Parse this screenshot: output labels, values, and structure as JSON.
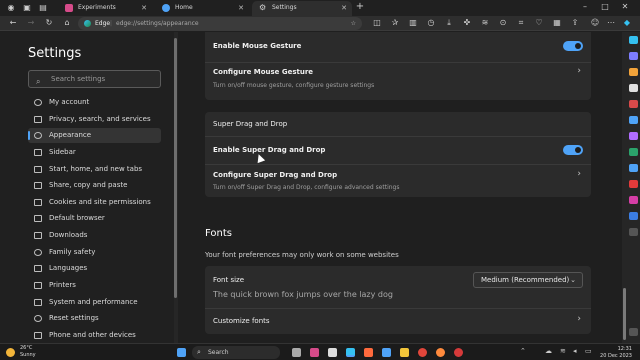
{
  "tabs": [
    {
      "label": "Experiments",
      "icon": "experiments-icon",
      "color": "#d64b8a"
    },
    {
      "label": "Home",
      "icon": "home-tab-icon",
      "color": "#4fa3f7"
    },
    {
      "label": "Settings",
      "icon": "gear-icon",
      "color": "#bdbdbd"
    }
  ],
  "address": {
    "browser_label": "Edge",
    "url": "edge://settings/appearance"
  },
  "sidebar": {
    "title": "Settings",
    "search_placeholder": "Search settings",
    "items": [
      {
        "label": "My account"
      },
      {
        "label": "Privacy, search, and services"
      },
      {
        "label": "Appearance"
      },
      {
        "label": "Sidebar"
      },
      {
        "label": "Start, home, and new tabs"
      },
      {
        "label": "Share, copy and paste"
      },
      {
        "label": "Cookies and site permissions"
      },
      {
        "label": "Default browser"
      },
      {
        "label": "Downloads"
      },
      {
        "label": "Family safety"
      },
      {
        "label": "Languages"
      },
      {
        "label": "Printers"
      },
      {
        "label": "System and performance"
      },
      {
        "label": "Reset settings"
      },
      {
        "label": "Phone and other devices"
      }
    ],
    "selected_index": 2
  },
  "main": {
    "mouse_gesture": {
      "enable_label": "Enable Mouse Gesture",
      "enable_on": true,
      "configure_label": "Configure Mouse Gesture",
      "configure_sub": "Turn on/off mouse gesture, configure gesture settings"
    },
    "super_drag": {
      "section_label": "Super Drag and Drop",
      "enable_label": "Enable Super Drag and Drop",
      "enable_on": true,
      "configure_label": "Configure Super Drag and Drop",
      "configure_sub": "Turn on/off Super Drag and Drop, configure advanced settings"
    },
    "fonts": {
      "heading": "Fonts",
      "description": "Your font preferences may only work on some websites",
      "font_size_label": "Font size",
      "font_size_value": "Medium (Recommended)",
      "preview_text": "The quick brown fox jumps over the lazy dog",
      "customize_label": "Customize fonts"
    }
  },
  "taskbar": {
    "weather_temp": "26°C",
    "weather_desc": "Sunny",
    "search_label": "Search",
    "time": "12:31",
    "date": "20 Dec 2023"
  },
  "colors": {
    "accent": "#4fa3f7",
    "background": "#1f1f1f",
    "card": "#2b2b2b"
  }
}
